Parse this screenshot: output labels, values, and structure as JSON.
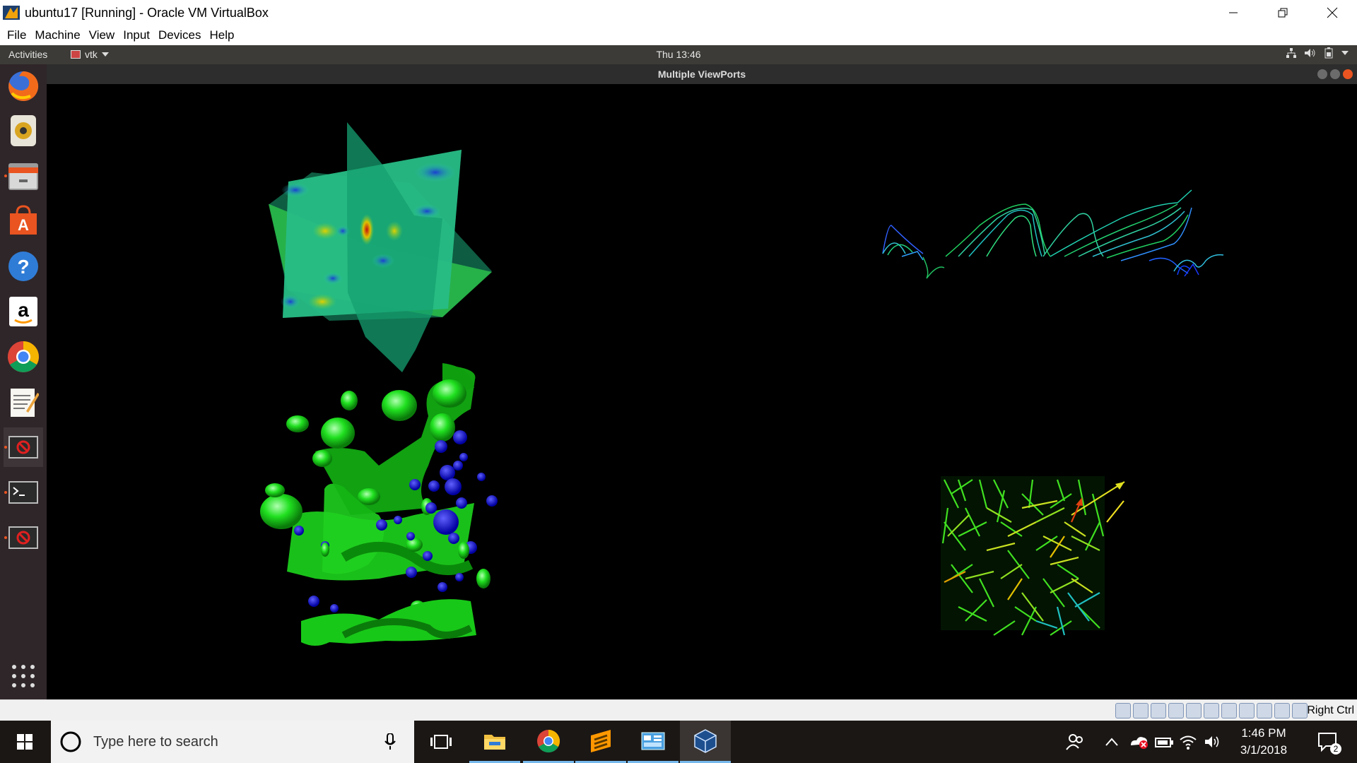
{
  "window": {
    "title": "ubuntu17 [Running] - Oracle VM VirtualBox"
  },
  "menubar": {
    "items": [
      "File",
      "Machine",
      "View",
      "Input",
      "Devices",
      "Help"
    ]
  },
  "gnome_topbar": {
    "activities": "Activities",
    "app_name": "vtk",
    "clock": "Thu 13:46"
  },
  "app_window": {
    "title": "Multiple ViewPorts"
  },
  "dock": {
    "items": [
      "firefox-icon",
      "rhythmbox-icon",
      "files-icon",
      "software-center-icon",
      "help-icon",
      "amazon-icon",
      "chrome-icon",
      "text-editor-icon",
      "vtk-app-icon",
      "terminal-icon",
      "vtk-app-icon",
      "show-apps-icon"
    ]
  },
  "statusbar": {
    "host_key": "Right Ctrl"
  },
  "taskbar": {
    "search_placeholder": "Type here to search",
    "time": "1:46 PM",
    "date": "3/1/2018",
    "notification_count": "2"
  },
  "colors": {
    "accent": "#e95420",
    "dock_bg": "#2f2629",
    "topbar_bg": "#3c3b37",
    "taskbar_bg": "#1b1715"
  }
}
